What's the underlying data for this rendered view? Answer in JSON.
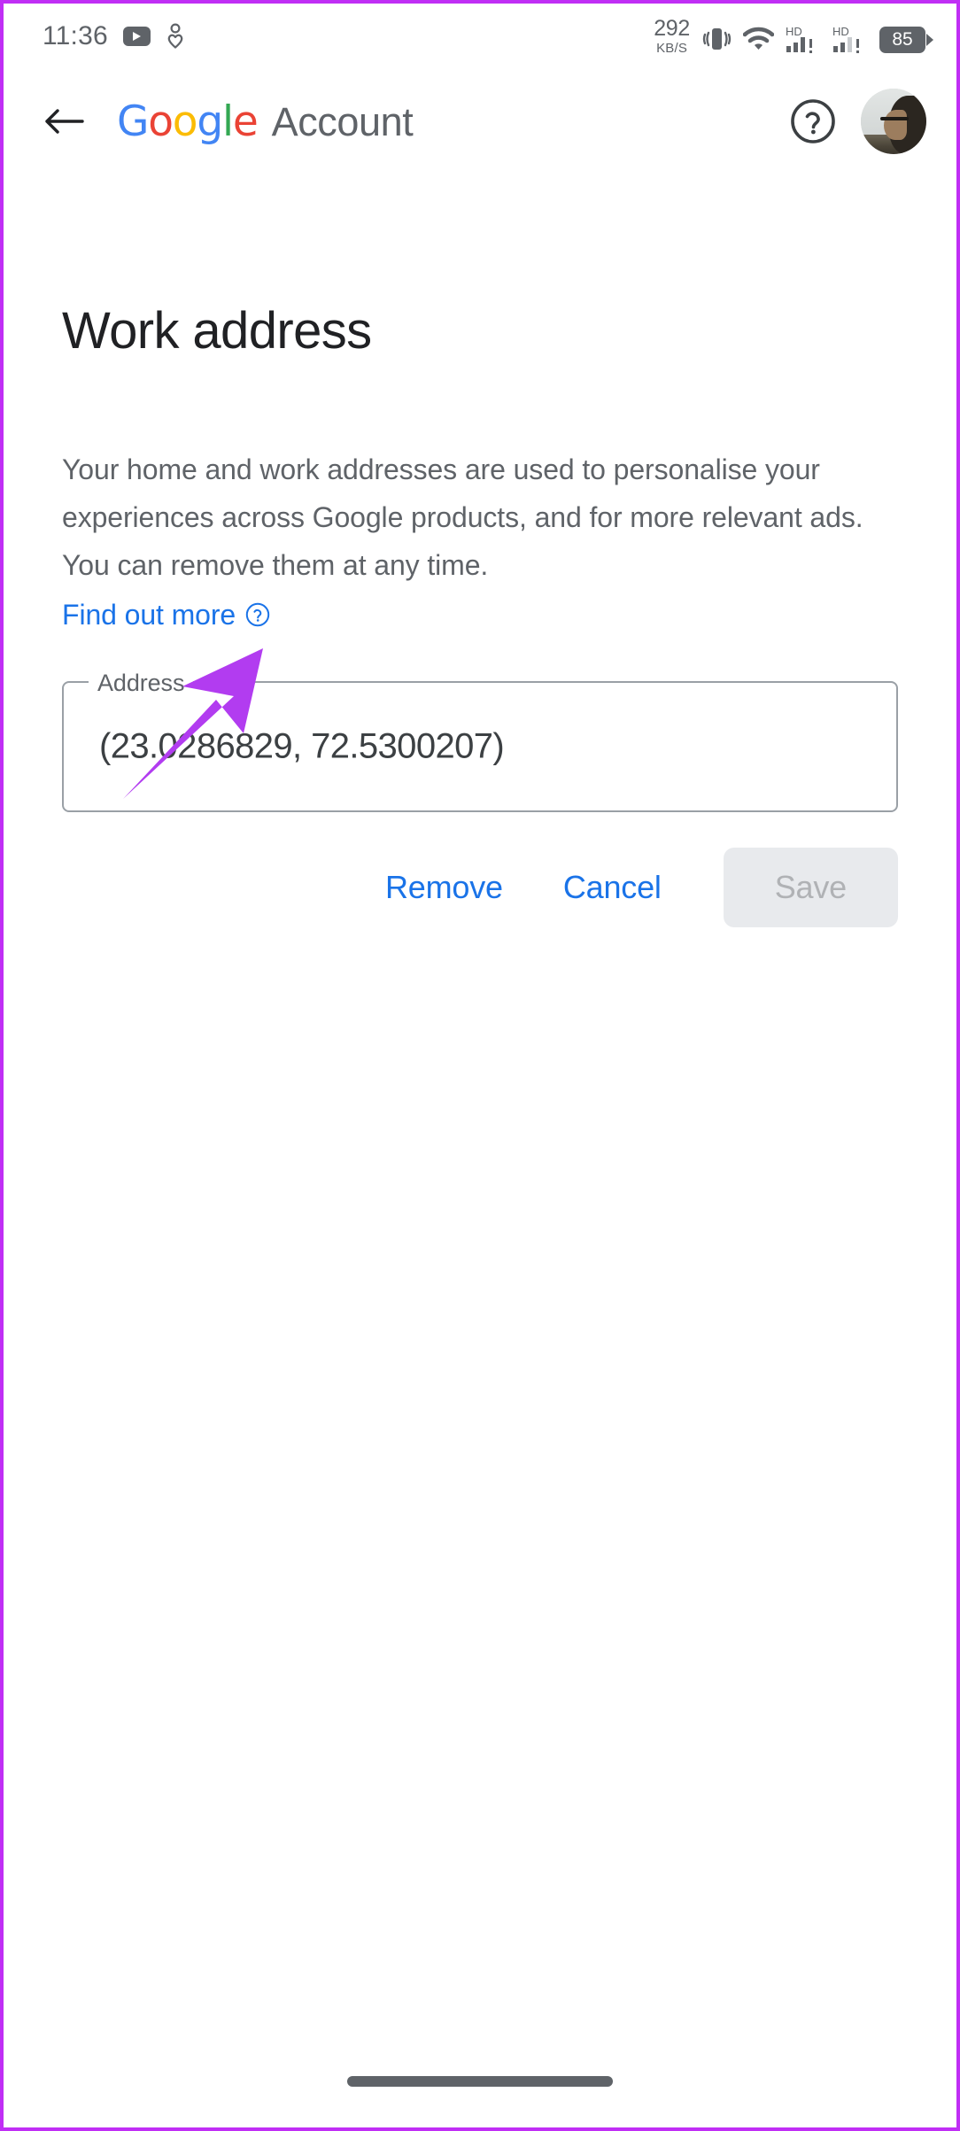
{
  "status_bar": {
    "time": "11:36",
    "youtube_icon": "youtube-icon",
    "heart_icon": "heart-person-icon",
    "network_speed_value": "292",
    "network_speed_unit": "KB/S",
    "vibrate_icon": "vibrate-icon",
    "wifi_icon": "wifi-icon",
    "signal_1_label": "HD",
    "signal_2_label": "HD",
    "battery_level": "85"
  },
  "app_bar": {
    "back_icon": "back-arrow-icon",
    "brand_g": "G",
    "brand_o1": "o",
    "brand_o2": "o",
    "brand_g2": "g",
    "brand_l": "l",
    "brand_e": "e",
    "brand_word": "Account",
    "help_icon": "help-circle-icon",
    "avatar": "profile-avatar"
  },
  "main": {
    "title": "Work address",
    "description": "Your home and work addresses are used to personalise your experiences across Google products, and for more relevant ads. You can remove them at any time.",
    "find_out_more": "Find out more",
    "find_out_more_icon": "help-circle-icon",
    "field": {
      "label": "Address",
      "value": "(23.0286829, 72.5300207)",
      "placeholder": "Address"
    },
    "buttons": {
      "remove": "Remove",
      "cancel": "Cancel",
      "save": "Save"
    }
  },
  "annotation": {
    "type": "arrow",
    "points_to": "Remove",
    "color": "#b23cf0"
  },
  "colors": {
    "accent_blue": "#1a73e8",
    "google_blue": "#4285f4",
    "google_red": "#ea4335",
    "google_yellow": "#fbbc05",
    "google_green": "#34a853",
    "text_primary": "#202124",
    "text_secondary": "#5f6368",
    "disabled_bg": "#e8eaed",
    "frame_purple": "#c02ef5"
  },
  "system": {
    "gesture_bar": "navigation-gesture-bar"
  }
}
